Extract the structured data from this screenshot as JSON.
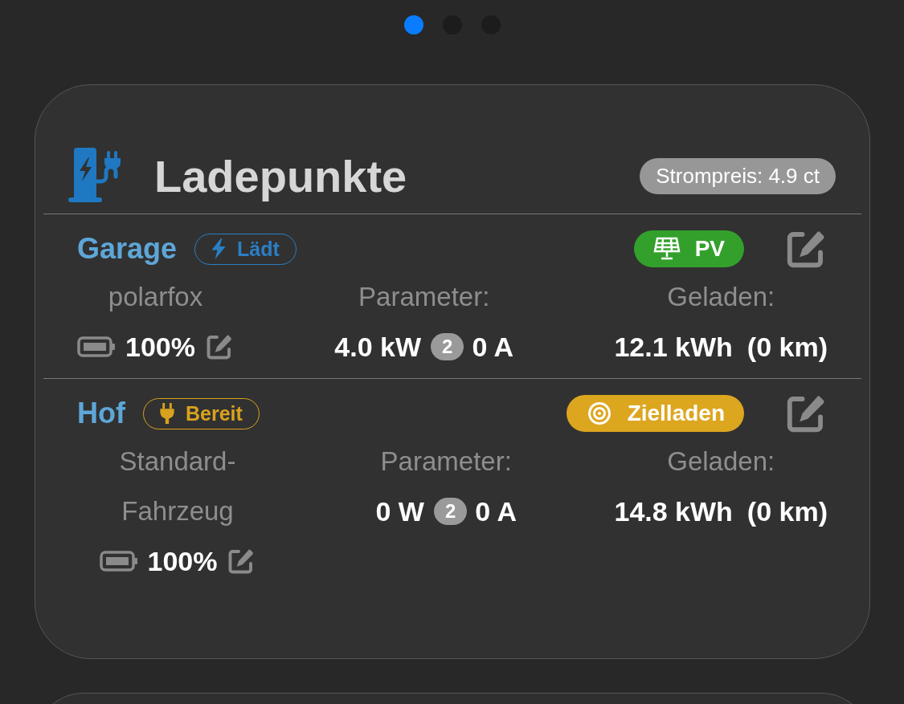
{
  "pager": {
    "dots": [
      {
        "selected": true
      },
      {
        "selected": false
      },
      {
        "selected": false
      }
    ]
  },
  "card": {
    "title": "Ladepunkte",
    "price_badge": "Strompreis: 4.9 ct",
    "charge_points": [
      {
        "name": "Garage",
        "status": {
          "kind": "charging",
          "label": "Lädt"
        },
        "mode": {
          "kind": "pv",
          "label": "PV"
        },
        "vehicle": "polarfox",
        "soc": "100%",
        "parameter_label": "Parameter:",
        "power": "4.0 kW",
        "phases": "2",
        "current": "0 A",
        "charged_label": "Geladen:",
        "energy": "12.1 kWh",
        "range": "(0 km)"
      },
      {
        "name": "Hof",
        "status": {
          "kind": "ready",
          "label": "Bereit"
        },
        "mode": {
          "kind": "target",
          "label": "Zielladen"
        },
        "vehicle": "Standard-Fahrzeug",
        "soc": "100%",
        "parameter_label": "Parameter:",
        "power": "0 W",
        "phases": "2",
        "current": "0 A",
        "charged_label": "Geladen:",
        "energy": "14.8 kWh",
        "range": "(0 km)"
      }
    ]
  }
}
